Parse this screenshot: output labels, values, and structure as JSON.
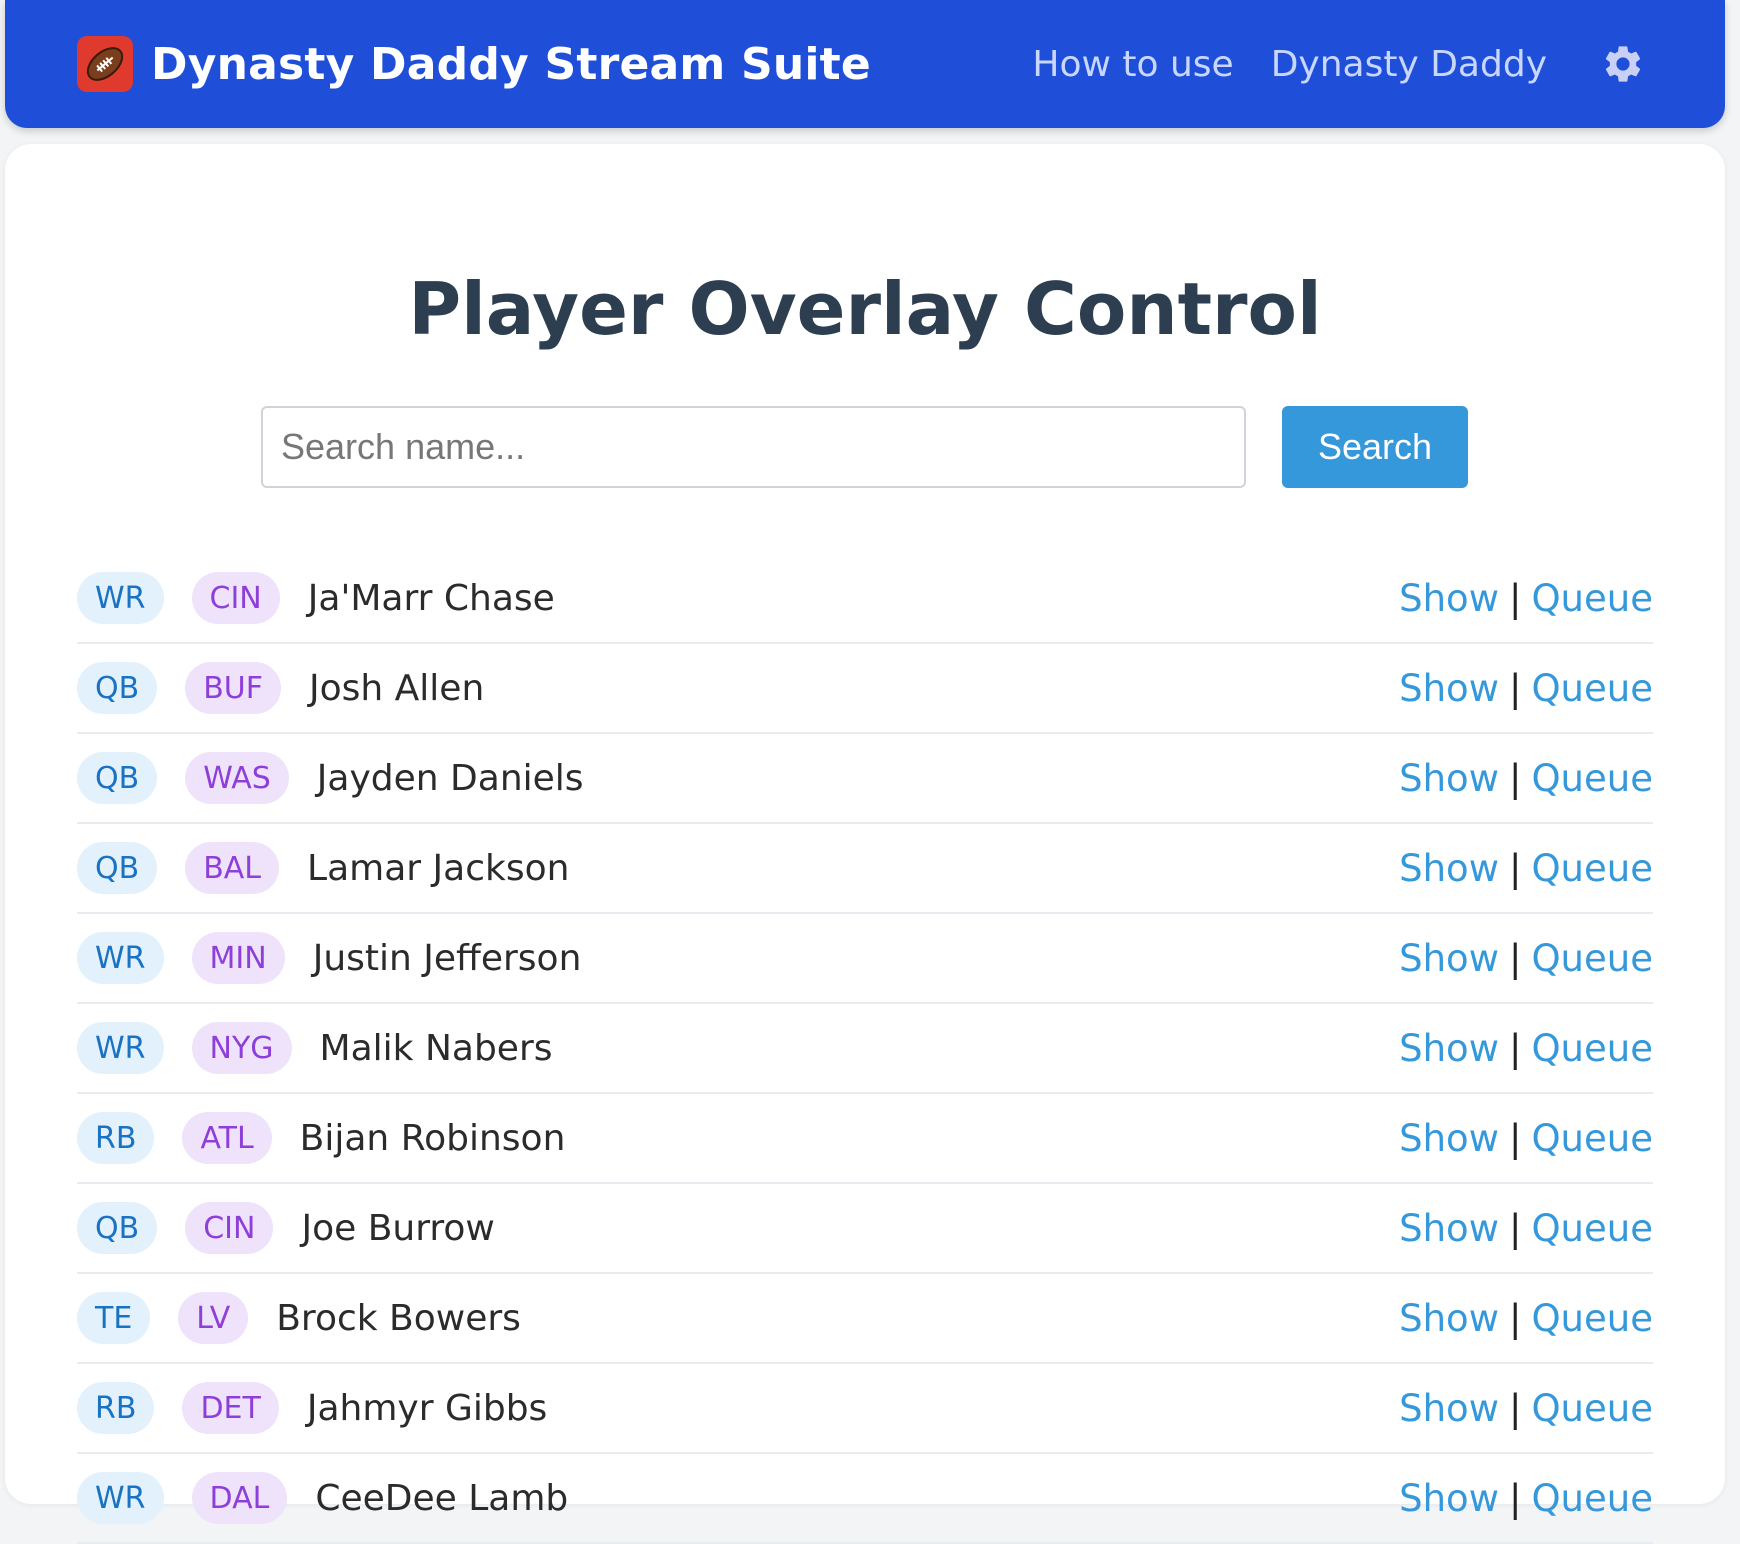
{
  "header": {
    "brand_icon": "football-icon",
    "title": "Dynasty Daddy Stream Suite",
    "nav": [
      {
        "label": "How to use"
      },
      {
        "label": "Dynasty Daddy"
      }
    ],
    "settings_icon": "gear-icon",
    "colors": {
      "background": "#1f4fd8",
      "nav_link": "#c9d7ff"
    }
  },
  "main": {
    "title": "Player Overlay Control",
    "search": {
      "placeholder": "Search name...",
      "value": "",
      "button_label": "Search"
    },
    "actions": {
      "show_label": "Show",
      "separator": "|",
      "queue_label": "Queue"
    },
    "players": [
      {
        "position": "WR",
        "team": "CIN",
        "name": "Ja'Marr Chase"
      },
      {
        "position": "QB",
        "team": "BUF",
        "name": "Josh Allen"
      },
      {
        "position": "QB",
        "team": "WAS",
        "name": "Jayden Daniels"
      },
      {
        "position": "QB",
        "team": "BAL",
        "name": "Lamar Jackson"
      },
      {
        "position": "WR",
        "team": "MIN",
        "name": "Justin Jefferson"
      },
      {
        "position": "WR",
        "team": "NYG",
        "name": "Malik Nabers"
      },
      {
        "position": "RB",
        "team": "ATL",
        "name": "Bijan Robinson"
      },
      {
        "position": "QB",
        "team": "CIN",
        "name": "Joe Burrow"
      },
      {
        "position": "TE",
        "team": "LV",
        "name": "Brock Bowers"
      },
      {
        "position": "RB",
        "team": "DET",
        "name": "Jahmyr Gibbs"
      },
      {
        "position": "WR",
        "team": "DAL",
        "name": "CeeDee Lamb"
      }
    ],
    "colors": {
      "accent": "#3498db",
      "title": "#2c3e50",
      "position_badge_bg": "#e3f1fc",
      "position_badge_text": "#1a73c2",
      "team_badge_bg": "#efe3fb",
      "team_badge_text": "#8e3fd9"
    }
  }
}
